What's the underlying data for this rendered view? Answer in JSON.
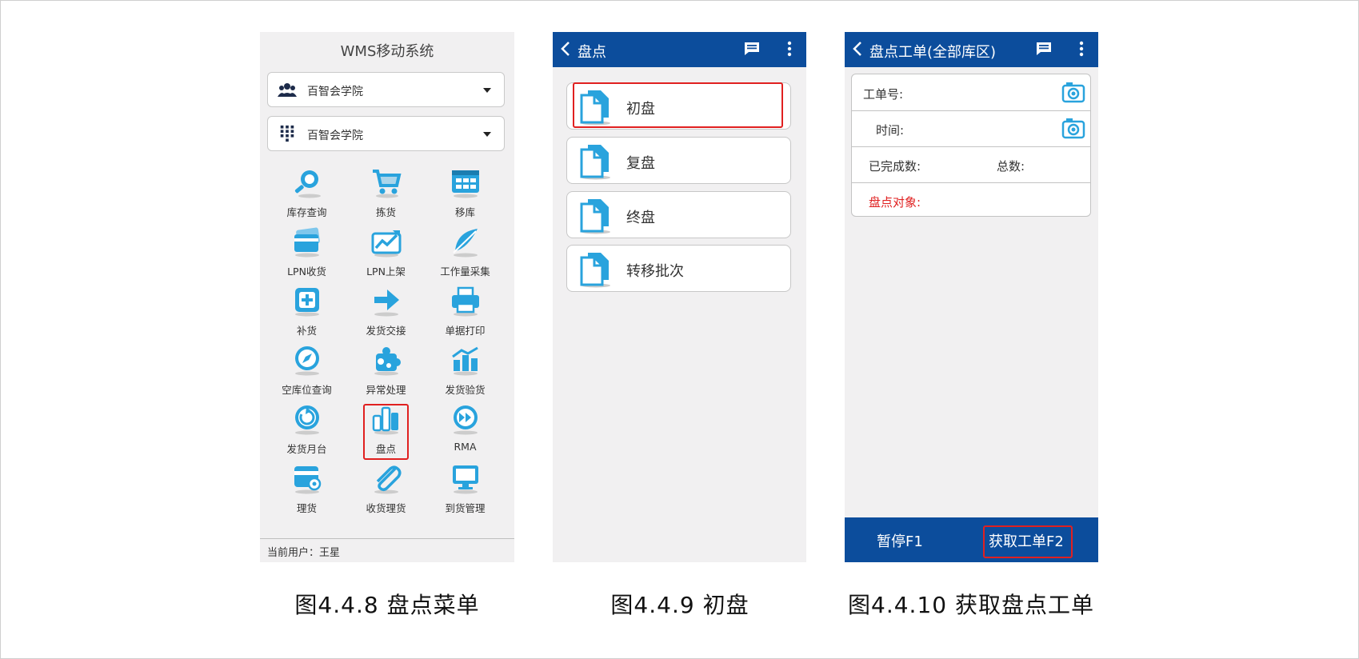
{
  "phone1": {
    "title": "WMS移动系统",
    "select_org": "百智会学院",
    "select_warehouse": "百智会学院",
    "grid": [
      {
        "label": "库存查询",
        "icon": "magnifier-icon"
      },
      {
        "label": "拣货",
        "icon": "cart-icon"
      },
      {
        "label": "移库",
        "icon": "grid-box-icon"
      },
      {
        "label": "LPN收货",
        "icon": "cards-icon"
      },
      {
        "label": "LPN上架",
        "icon": "chart-up-icon"
      },
      {
        "label": "工作量采集",
        "icon": "feather-icon"
      },
      {
        "label": "补货",
        "icon": "plus-box-icon"
      },
      {
        "label": "发货交接",
        "icon": "arrow-right-icon"
      },
      {
        "label": "单据打印",
        "icon": "printer-icon"
      },
      {
        "label": "空库位查询",
        "icon": "compass-icon"
      },
      {
        "label": "异常处理",
        "icon": "puzzle-icon"
      },
      {
        "label": "发货验货",
        "icon": "bar-chart-icon"
      },
      {
        "label": "发货月台",
        "icon": "refresh-icon"
      },
      {
        "label": "盘点",
        "icon": "bars-icon"
      },
      {
        "label": "RMA",
        "icon": "fast-forward-icon"
      },
      {
        "label": "理货",
        "icon": "drive-icon"
      },
      {
        "label": "收货理货",
        "icon": "paperclip-icon"
      },
      {
        "label": "到货管理",
        "icon": "monitor-icon"
      }
    ],
    "current_user_label": "当前用户：",
    "current_user": "王星"
  },
  "phone2": {
    "title": "盘点",
    "items": [
      "初盘",
      "复盘",
      "终盘",
      "转移批次"
    ]
  },
  "phone3": {
    "title": "盘点工单(全部库区)",
    "work_order_label": "工单号:",
    "time_label": "时间:",
    "completed_label": "已完成数:",
    "total_label": "总数:",
    "target_label": "盘点对象:",
    "pause_button": "暂停F1",
    "fetch_button": "获取工单F2"
  },
  "captions": {
    "fig1": "图4.4.8 盘点菜单",
    "fig2": "图4.4.9 初盘",
    "fig3": "图4.4.10 获取盘点工单"
  },
  "colors": {
    "appbar": "#0c4d9c",
    "accent_icon": "#29a3dd",
    "highlight": "#e02020",
    "target_label": "#e02020"
  }
}
